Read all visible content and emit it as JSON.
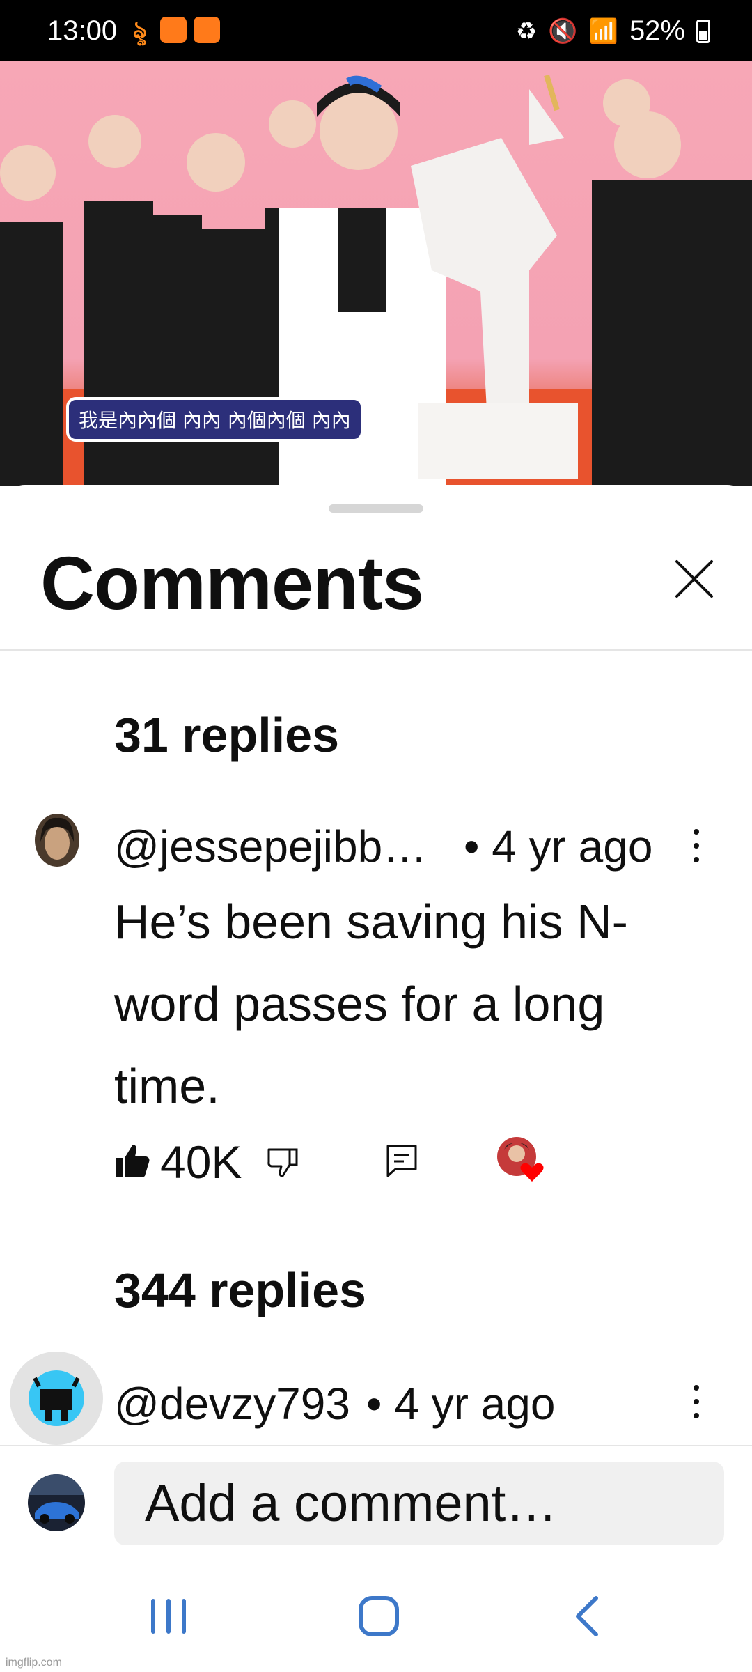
{
  "status_bar": {
    "time": "13:00",
    "battery": "52%"
  },
  "video": {
    "subtitle": "我是內內個 內內 內個內個 內內",
    "progress_fraction": 0.28
  },
  "sheet": {
    "title": "Comments"
  },
  "comments": [
    {
      "replies_label": "31 replies",
      "author": "@jessepejibb…",
      "time": "• 4 yr ago",
      "text": "He’s been saving his N-word passes for a long time.",
      "likes": "40K"
    },
    {
      "replies_label": "344 replies",
      "author": "@devzy793",
      "time": "• 4 yr ago"
    }
  ],
  "composer": {
    "placeholder": "Add a comment…"
  },
  "footer": {
    "watermark": "imgflip.com"
  },
  "icons": {
    "close": "close-icon",
    "more": "more-vert-icon",
    "like": "thumbs-up-icon",
    "dislike": "thumbs-down-icon",
    "reply": "reply-icon"
  },
  "colors": {
    "progress": "#ff0000",
    "heart": "#ff0000",
    "nav_buttons": "#3d78c9"
  }
}
